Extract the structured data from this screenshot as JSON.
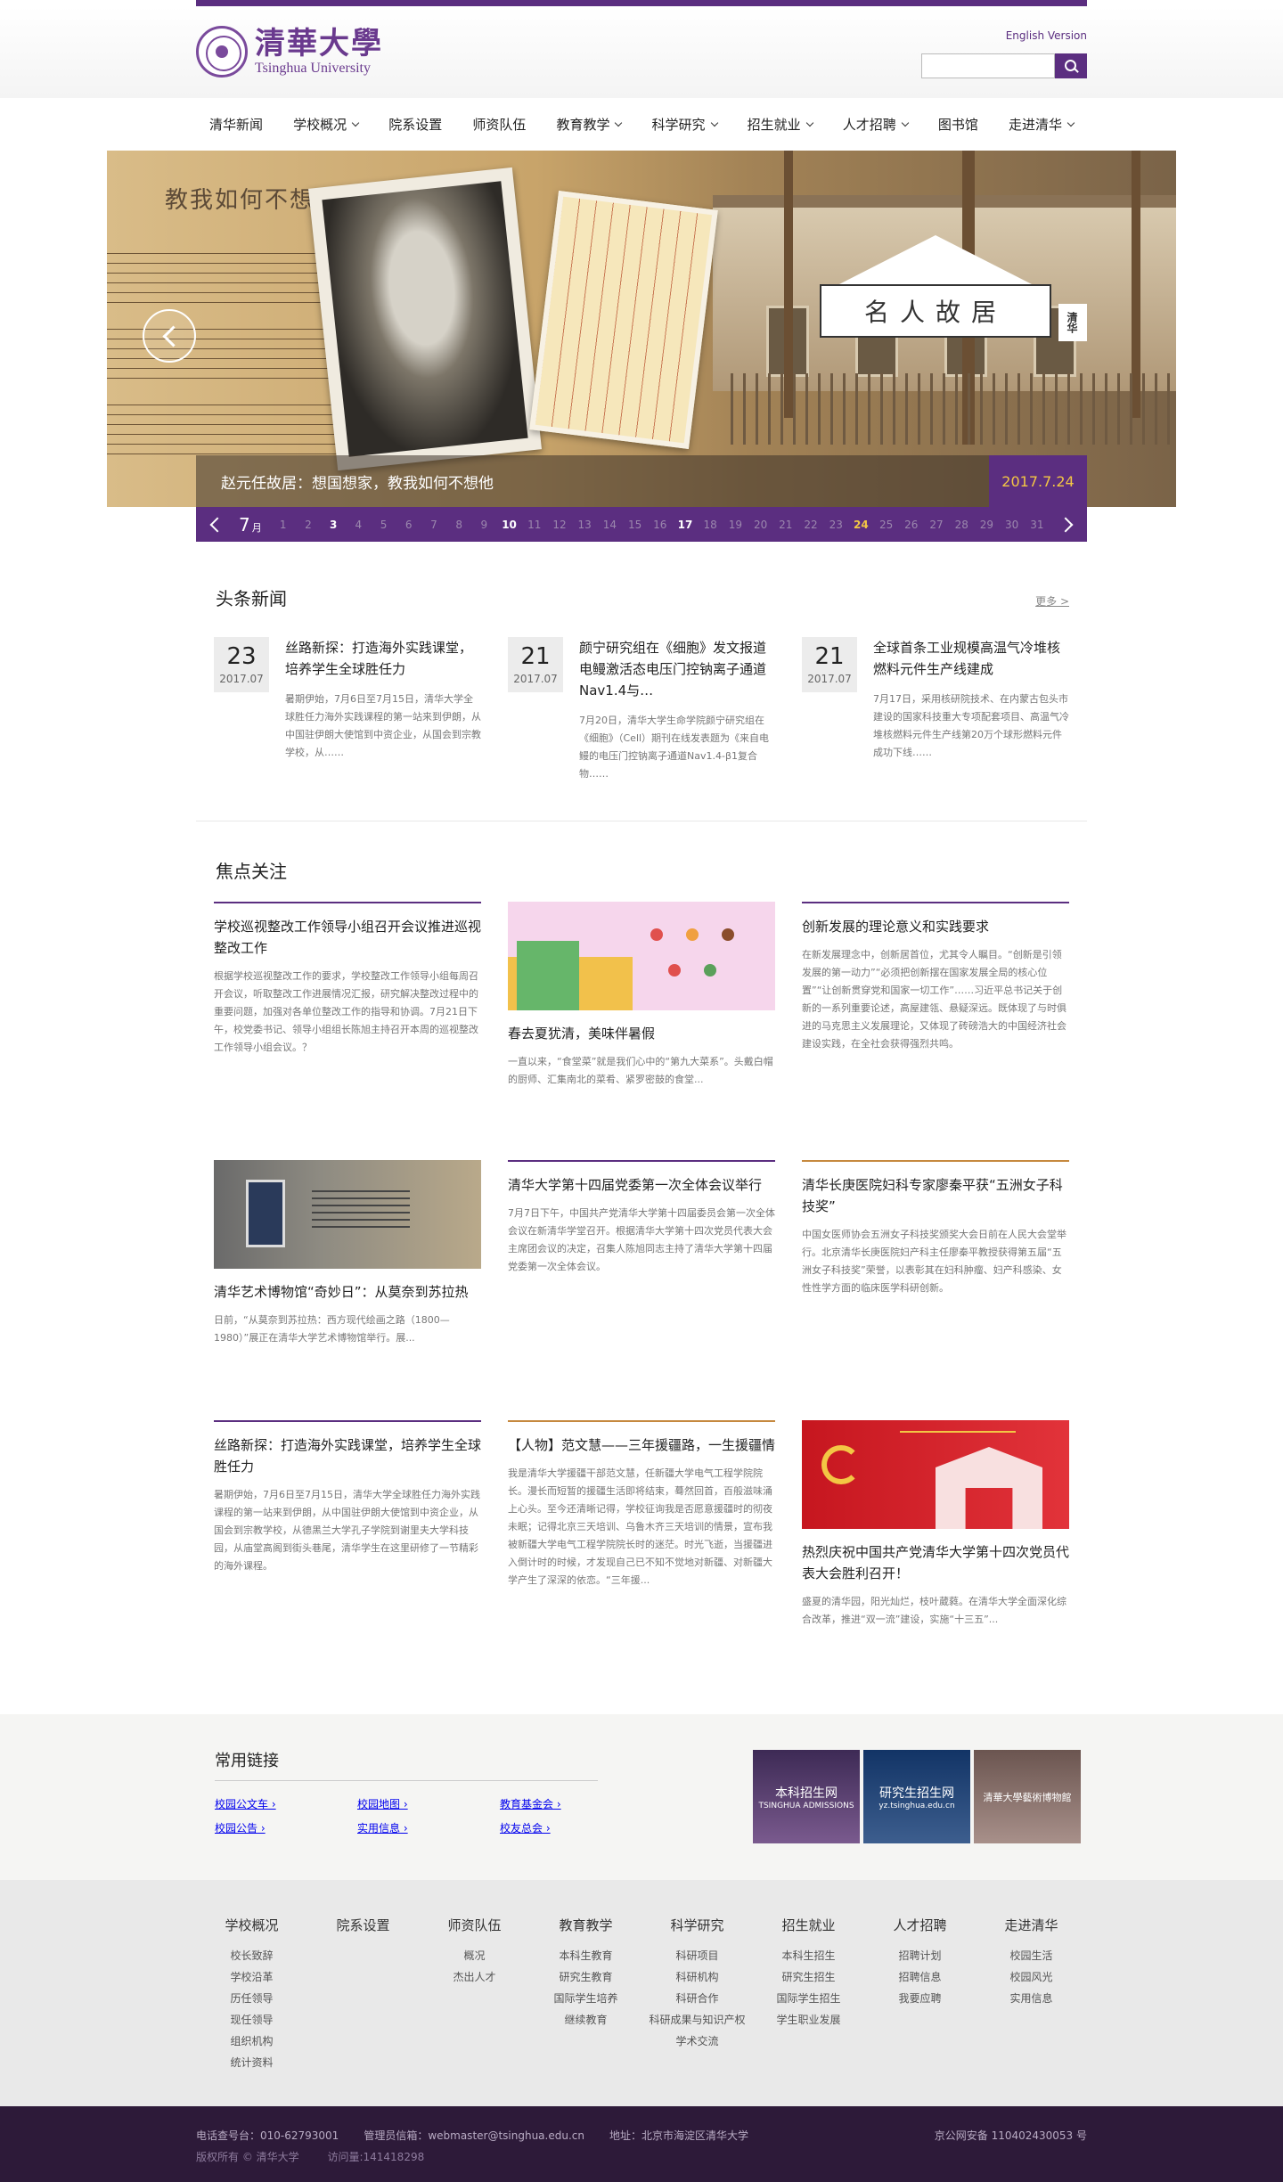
{
  "header": {
    "logo_cn": "清華大學",
    "logo_en": "Tsinghua University",
    "english_link": "English Version",
    "search_placeholder": ""
  },
  "nav": [
    {
      "label": "清华新闻",
      "dropdown": false
    },
    {
      "label": "学校概况",
      "dropdown": true
    },
    {
      "label": "院系设置",
      "dropdown": false
    },
    {
      "label": "师资队伍",
      "dropdown": false
    },
    {
      "label": "教育教学",
      "dropdown": true
    },
    {
      "label": "科学研究",
      "dropdown": true
    },
    {
      "label": "招生就业",
      "dropdown": true
    },
    {
      "label": "人才招聘",
      "dropdown": true
    },
    {
      "label": "图书馆",
      "dropdown": false
    },
    {
      "label": "走进清华",
      "dropdown": true
    }
  ],
  "banner": {
    "slogan": "教我如何不想他",
    "plaque": "名人故居",
    "plaque_tag": "清华",
    "caption": "赵元任故居：想国想家，教我如何不想他",
    "date": "2017.7.24"
  },
  "datebar": {
    "month": "7",
    "month_unit": "月",
    "days": [
      "1",
      "2",
      "3",
      "4",
      "5",
      "6",
      "7",
      "8",
      "9",
      "10",
      "11",
      "12",
      "13",
      "14",
      "15",
      "16",
      "17",
      "18",
      "19",
      "20",
      "21",
      "22",
      "23",
      "24",
      "25",
      "26",
      "27",
      "28",
      "29",
      "30",
      "31"
    ]
  },
  "headlines": {
    "title": "头条新闻",
    "more": "更多 >",
    "items": [
      {
        "day": "23",
        "month": "2017.07",
        "title": "丝路新探：打造海外实践课堂，培养学生全球胜任力",
        "summary": "暑期伊始，7月6日至7月15日，清华大学全球胜任力海外实践课程的第一站来到伊朗，从中国驻伊朗大使馆到中资企业，从国会到宗教学校，从……"
      },
      {
        "day": "21",
        "month": "2017.07",
        "title": "颜宁研究组在《细胞》发文报道电鳗激活态电压门控钠离子通道Nav1.4与…",
        "summary": "7月20日，清华大学生命学院颜宁研究组在《细胞》（Cell）期刊在线发表题为《来自电鳗的电压门控钠离子通道Nav1.4-β1复合物……"
      },
      {
        "day": "21",
        "month": "2017.07",
        "title": "全球首条工业规模高温气冷堆核燃料元件生产线建成",
        "summary": "7月17日，采用核研院技术、在内蒙古包头市建设的国家科技重大专项配套项目、高温气冷堆核燃料元件生产线第20万个球形燃料元件成功下线……"
      }
    ]
  },
  "focus": {
    "title": "焦点关注",
    "row1": [
      {
        "title": "学校巡视整改工作领导小组召开会议推进巡视整改工作",
        "summary": "根据学校巡视整改工作的要求，学校整改工作领导小组每周召开会议，听取整改工作进展情况汇报，研究解决整改过程中的重要问题，加强对各单位整改工作的指导和协调。7月21日下午，校党委书记、领导小组组长陈旭主持召开本周的巡视整改工作领导小组会议。？"
      },
      {
        "title": "春去夏犹清，美味伴暑假",
        "summary": "一直以来，“食堂菜”就是我们心中的“第九大菜系”。头戴白帽的厨师、汇集南北的菜肴、紧罗密鼓的食堂..."
      },
      {
        "title": "创新发展的理论意义和实践要求",
        "summary": "在新发展理念中，创新居首位，尤其令人瞩目。“创新是引领发展的第一动力”“必须把创新摆在国家发展全局的核心位置”“让创新贯穿党和国家一切工作”……习近平总书记关于创新的一系列重要论述，高屋建瓴、悬疑深远。既体现了与时俱进的马克思主义发展理论，又体现了砖磅浩大的中国经济社会建设实践，在全社会获得强烈共鸣。"
      }
    ],
    "row2": [
      {
        "title": "清华艺术博物馆“奇妙日”：从莫奈到苏拉热",
        "summary": "日前，“从莫奈到苏拉热：西方现代绘画之路（1800—1980）”展正在清华大学艺术博物馆举行。展..."
      },
      {
        "title": "清华大学第十四届党委第一次全体会议举行",
        "summary": "7月7日下午，中国共产党清华大学第十四届委员会第一次全体会议在新清华学堂召开。根据清华大学第十四次党员代表大会主席团会议的决定，召集人陈旭同志主持了清华大学第十四届党委第一次全体会议。"
      },
      {
        "title": "清华长庚医院妇科专家廖秦平获“五洲女子科技奖”",
        "summary": "中国女医师协会五洲女子科技奖颁奖大会日前在人民大会堂举行。北京清华长庚医院妇产科主任廖秦平教授获得第五届“五洲女子科技奖”荣誉，以表彰其在妇科肿瘤、妇产科感染、女性性学方面的临床医学科研创新。"
      }
    ],
    "row3": [
      {
        "title": "丝路新探：打造海外实践课堂，培养学生全球胜任力",
        "summary": "暑期伊始，7月6日至7月15日，清华大学全球胜任力海外实践课程的第一站来到伊朗，从中国驻伊朗大使馆到中资企业，从国会到宗教学校，从德黑兰大学孔子学院到谢里夫大学科技园，从庙堂高阁到街头巷尾，清华学生在这里研修了一节精彩的海外课程。"
      },
      {
        "title": "【人物】范文慧——三年援疆路，一生援疆情",
        "summary": "我是清华大学援疆干部范文慧，任新疆大学电气工程学院院长。漫长而短暂的援疆生活即将结束，蓦然回首，百般滋味涌上心头。至今还清晰记得，学校征询我是否愿意援疆时的彻夜未眠；记得北京三天培训、乌鲁木齐三天培训的情景，宣布我被新疆大学电气工程学院院长时的迷茫。时光飞逝，当援疆进入倒计时的时候，才发现自己已不知不觉地对新疆、对新疆大学产生了深深的依恋。“三年援..."
      },
      {
        "title": "热烈庆祝中国共产党清华大学第十四次党员代表大会胜利召开！",
        "summary": "盛夏的清华园，阳光灿烂，枝叶葳蕤。在清华大学全面深化综合改革，推进“双一流”建设，实施“十三五”..."
      }
    ]
  },
  "quick_links": {
    "title": "常用链接",
    "items": [
      "校园公文车",
      "校园地图",
      "教育基金会",
      "校园公告",
      "实用信息",
      "校友总会"
    ],
    "promos": [
      {
        "label": "本科招生网",
        "sub": "TSINGHUA ADMISSIONS"
      },
      {
        "label": "研究生招生网",
        "sub": "yz.tsinghua.edu.cn"
      },
      {
        "label": "清華大學藝術博物館",
        "sub": ""
      }
    ]
  },
  "footer": {
    "columns": [
      {
        "title": "学校概况",
        "links": [
          "校长致辞",
          "学校沿革",
          "历任领导",
          "现任领导",
          "组织机构",
          "统计资料"
        ]
      },
      {
        "title": "院系设置",
        "links": []
      },
      {
        "title": "师资队伍",
        "links": [
          "概况",
          "杰出人才"
        ]
      },
      {
        "title": "教育教学",
        "links": [
          "本科生教育",
          "研究生教育",
          "国际学生培养",
          "继续教育"
        ]
      },
      {
        "title": "科学研究",
        "links": [
          "科研项目",
          "科研机构",
          "科研合作",
          "科研成果与知识产权",
          "学术交流"
        ]
      },
      {
        "title": "招生就业",
        "links": [
          "本科生招生",
          "研究生招生",
          "国际学生招生",
          "学生职业发展"
        ]
      },
      {
        "title": "人才招聘",
        "links": [
          "招聘计划",
          "招聘信息",
          "我要应聘"
        ]
      },
      {
        "title": "走进清华",
        "links": [
          "校园生活",
          "校园风光",
          "实用信息"
        ]
      }
    ],
    "phone": "电话查号台：010-62793001",
    "email": "管理员信箱：webmaster@tsinghua.edu.cn",
    "address": "地址：北京市海淀区清华大学",
    "icp": "京公网安备 110402430053 号",
    "copyright": "版权所有 © 清华大学",
    "visits": "访问量:141418298"
  },
  "colors": {
    "brand": "#5b2e80",
    "accent": "#f3c644",
    "orange": "#c6893f"
  }
}
